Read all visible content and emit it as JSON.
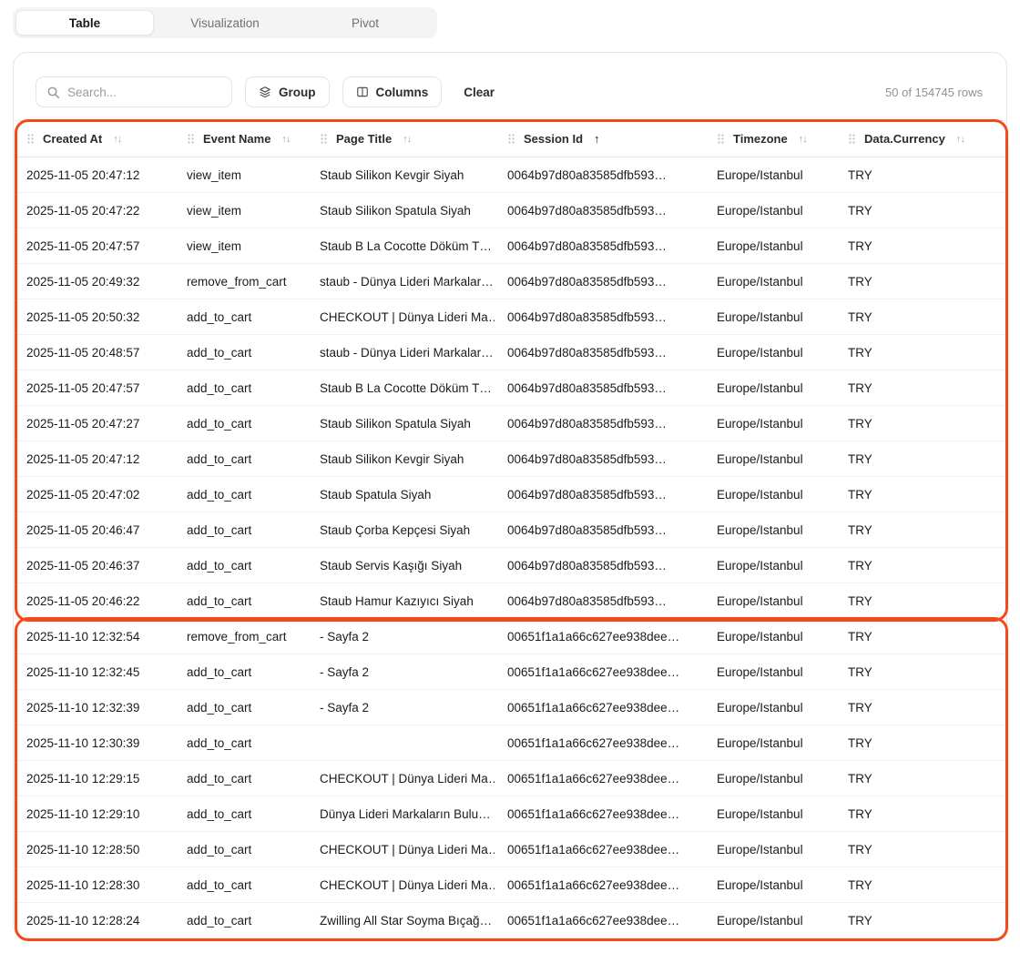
{
  "tabs": {
    "items": [
      {
        "label": "Table",
        "active": true
      },
      {
        "label": "Visualization",
        "active": false
      },
      {
        "label": "Pivot",
        "active": false
      }
    ]
  },
  "toolbar": {
    "search_placeholder": "Search...",
    "group_label": "Group",
    "columns_label": "Columns",
    "clear_label": "Clear",
    "row_count": "50 of 154745 rows"
  },
  "table": {
    "columns": [
      {
        "label": "Created At",
        "sort": "both"
      },
      {
        "label": "Event Name",
        "sort": "both"
      },
      {
        "label": "Page Title",
        "sort": "both"
      },
      {
        "label": "Session Id",
        "sort": "asc"
      },
      {
        "label": "Timezone",
        "sort": "both"
      },
      {
        "label": "Data.Currency",
        "sort": "both"
      }
    ],
    "rows": [
      [
        "2025-11-05 20:47:12",
        "view_item",
        "Staub Silikon Kevgir Siyah",
        "0064b97d80a83585dfb593…",
        "Europe/Istanbul",
        "TRY"
      ],
      [
        "2025-11-05 20:47:22",
        "view_item",
        "Staub Silikon Spatula Siyah",
        "0064b97d80a83585dfb593…",
        "Europe/Istanbul",
        "TRY"
      ],
      [
        "2025-11-05 20:47:57",
        "view_item",
        "Staub B La Cocotte Döküm T…",
        "0064b97d80a83585dfb593…",
        "Europe/Istanbul",
        "TRY"
      ],
      [
        "2025-11-05 20:49:32",
        "remove_from_cart",
        "staub - Dünya Lideri Markalar…",
        "0064b97d80a83585dfb593…",
        "Europe/Istanbul",
        "TRY"
      ],
      [
        "2025-11-05 20:50:32",
        "add_to_cart",
        "CHECKOUT | Dünya Lideri Ma…",
        "0064b97d80a83585dfb593…",
        "Europe/Istanbul",
        "TRY"
      ],
      [
        "2025-11-05 20:48:57",
        "add_to_cart",
        "staub - Dünya Lideri Markalar…",
        "0064b97d80a83585dfb593…",
        "Europe/Istanbul",
        "TRY"
      ],
      [
        "2025-11-05 20:47:57",
        "add_to_cart",
        "Staub B La Cocotte Döküm T…",
        "0064b97d80a83585dfb593…",
        "Europe/Istanbul",
        "TRY"
      ],
      [
        "2025-11-05 20:47:27",
        "add_to_cart",
        "Staub Silikon Spatula Siyah",
        "0064b97d80a83585dfb593…",
        "Europe/Istanbul",
        "TRY"
      ],
      [
        "2025-11-05 20:47:12",
        "add_to_cart",
        "Staub Silikon Kevgir Siyah",
        "0064b97d80a83585dfb593…",
        "Europe/Istanbul",
        "TRY"
      ],
      [
        "2025-11-05 20:47:02",
        "add_to_cart",
        "Staub Spatula Siyah",
        "0064b97d80a83585dfb593…",
        "Europe/Istanbul",
        "TRY"
      ],
      [
        "2025-11-05 20:46:47",
        "add_to_cart",
        "Staub Çorba Kepçesi Siyah",
        "0064b97d80a83585dfb593…",
        "Europe/Istanbul",
        "TRY"
      ],
      [
        "2025-11-05 20:46:37",
        "add_to_cart",
        "Staub Servis Kaşığı Siyah",
        "0064b97d80a83585dfb593…",
        "Europe/Istanbul",
        "TRY"
      ],
      [
        "2025-11-05 20:46:22",
        "add_to_cart",
        "Staub Hamur Kazıyıcı Siyah",
        "0064b97d80a83585dfb593…",
        "Europe/Istanbul",
        "TRY"
      ],
      [
        "2025-11-10 12:32:54",
        "remove_from_cart",
        "- Sayfa 2",
        "00651f1a1a66c627ee938dee…",
        "Europe/Istanbul",
        "TRY"
      ],
      [
        "2025-11-10 12:32:45",
        "add_to_cart",
        "- Sayfa 2",
        "00651f1a1a66c627ee938dee…",
        "Europe/Istanbul",
        "TRY"
      ],
      [
        "2025-11-10 12:32:39",
        "add_to_cart",
        "- Sayfa 2",
        "00651f1a1a66c627ee938dee…",
        "Europe/Istanbul",
        "TRY"
      ],
      [
        "2025-11-10 12:30:39",
        "add_to_cart",
        "",
        "00651f1a1a66c627ee938dee…",
        "Europe/Istanbul",
        "TRY"
      ],
      [
        "2025-11-10 12:29:15",
        "add_to_cart",
        "CHECKOUT | Dünya Lideri Ma…",
        "00651f1a1a66c627ee938dee…",
        "Europe/Istanbul",
        "TRY"
      ],
      [
        "2025-11-10 12:29:10",
        "add_to_cart",
        "Dünya Lideri Markaların Bulu…",
        "00651f1a1a66c627ee938dee…",
        "Europe/Istanbul",
        "TRY"
      ],
      [
        "2025-11-10 12:28:50",
        "add_to_cart",
        "CHECKOUT | Dünya Lideri Ma…",
        "00651f1a1a66c627ee938dee…",
        "Europe/Istanbul",
        "TRY"
      ],
      [
        "2025-11-10 12:28:30",
        "add_to_cart",
        "CHECKOUT | Dünya Lideri Ma…",
        "00651f1a1a66c627ee938dee…",
        "Europe/Istanbul",
        "TRY"
      ],
      [
        "2025-11-10 12:28:24",
        "add_to_cart",
        "Zwilling All Star Soyma Bıçağ…",
        "00651f1a1a66c627ee938dee…",
        "Europe/Istanbul",
        "TRY"
      ]
    ]
  },
  "annotations": {
    "color": "#f24a19",
    "groups": [
      {
        "include_header": true,
        "first_row": 0,
        "last_row": 12
      },
      {
        "include_header": false,
        "first_row": 13,
        "last_row": 21
      }
    ]
  }
}
